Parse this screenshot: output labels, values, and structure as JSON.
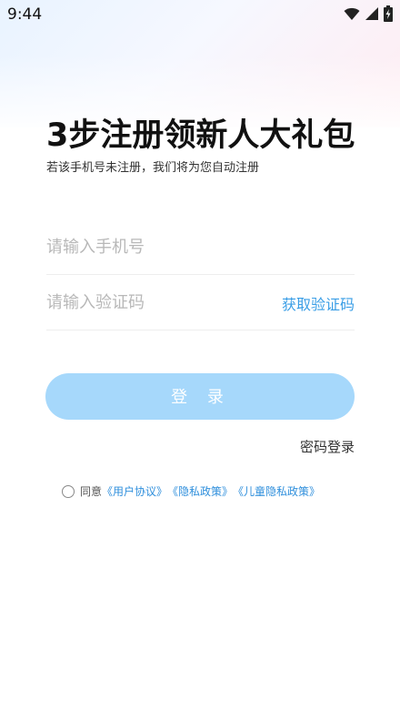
{
  "status_bar": {
    "time": "9:44",
    "icons": [
      "wifi-icon",
      "cellular-signal-icon",
      "battery-charging-icon"
    ]
  },
  "header": {
    "title": "3步注册领新人大礼包",
    "subtitle": "若该手机号未注册，我们将为您自动注册"
  },
  "form": {
    "phone_placeholder": "请输入手机号",
    "code_placeholder": "请输入验证码",
    "get_code_label": "获取验证码",
    "login_label": "登 录",
    "password_login_label": "密码登录"
  },
  "agreement": {
    "prefix": "同意",
    "user_agreement": "《用户协议》",
    "privacy_policy": "《隐私政策》",
    "child_privacy_policy": "《儿童隐私政策》"
  },
  "colors": {
    "accent": "#3a9ee6",
    "button_bg": "#a6d8fb",
    "link": "#2f8fdc"
  }
}
